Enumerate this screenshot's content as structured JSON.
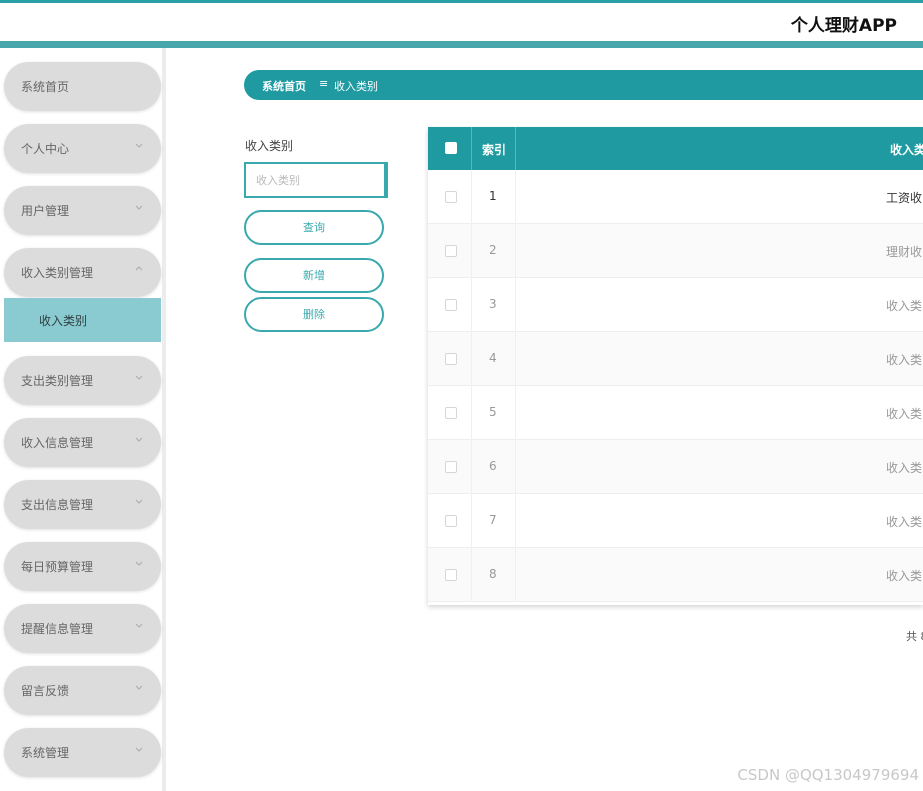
{
  "header": {
    "app_title": "个人理财APP"
  },
  "sidebar": {
    "items": [
      {
        "label": "系统首页"
      },
      {
        "label": "个人中心"
      },
      {
        "label": "用户管理"
      },
      {
        "label": "收入类别管理"
      },
      {
        "label": "支出类别管理"
      },
      {
        "label": "收入信息管理"
      },
      {
        "label": "支出信息管理"
      },
      {
        "label": "每日预算管理"
      },
      {
        "label": "提醒信息管理"
      },
      {
        "label": "留言反馈"
      },
      {
        "label": "系统管理"
      }
    ],
    "sub_item": {
      "label": "收入类别"
    }
  },
  "breadcrumb": {
    "home": "系统首页",
    "separator": "≡",
    "current": "收入类别"
  },
  "search": {
    "label": "收入类别",
    "placeholder": "收入类别",
    "value": ""
  },
  "buttons": {
    "query": "查询",
    "add": "新增",
    "delete": "删除"
  },
  "table": {
    "columns": [
      "索引",
      "收入类"
    ],
    "rows": [
      {
        "index": "1",
        "name": "工资收"
      },
      {
        "index": "2",
        "name": "理财收"
      },
      {
        "index": "3",
        "name": "收入类"
      },
      {
        "index": "4",
        "name": "收入类"
      },
      {
        "index": "5",
        "name": "收入类"
      },
      {
        "index": "6",
        "name": "收入类"
      },
      {
        "index": "7",
        "name": "收入类"
      },
      {
        "index": "8",
        "name": "收入类"
      }
    ]
  },
  "pager": {
    "text": "共 8"
  },
  "watermark": "CSDN @QQ1304979694",
  "colors": {
    "accent": "#1f9aa1",
    "sidebar_active": "#8acbd1",
    "menu_bg": "#dcdcdc"
  }
}
